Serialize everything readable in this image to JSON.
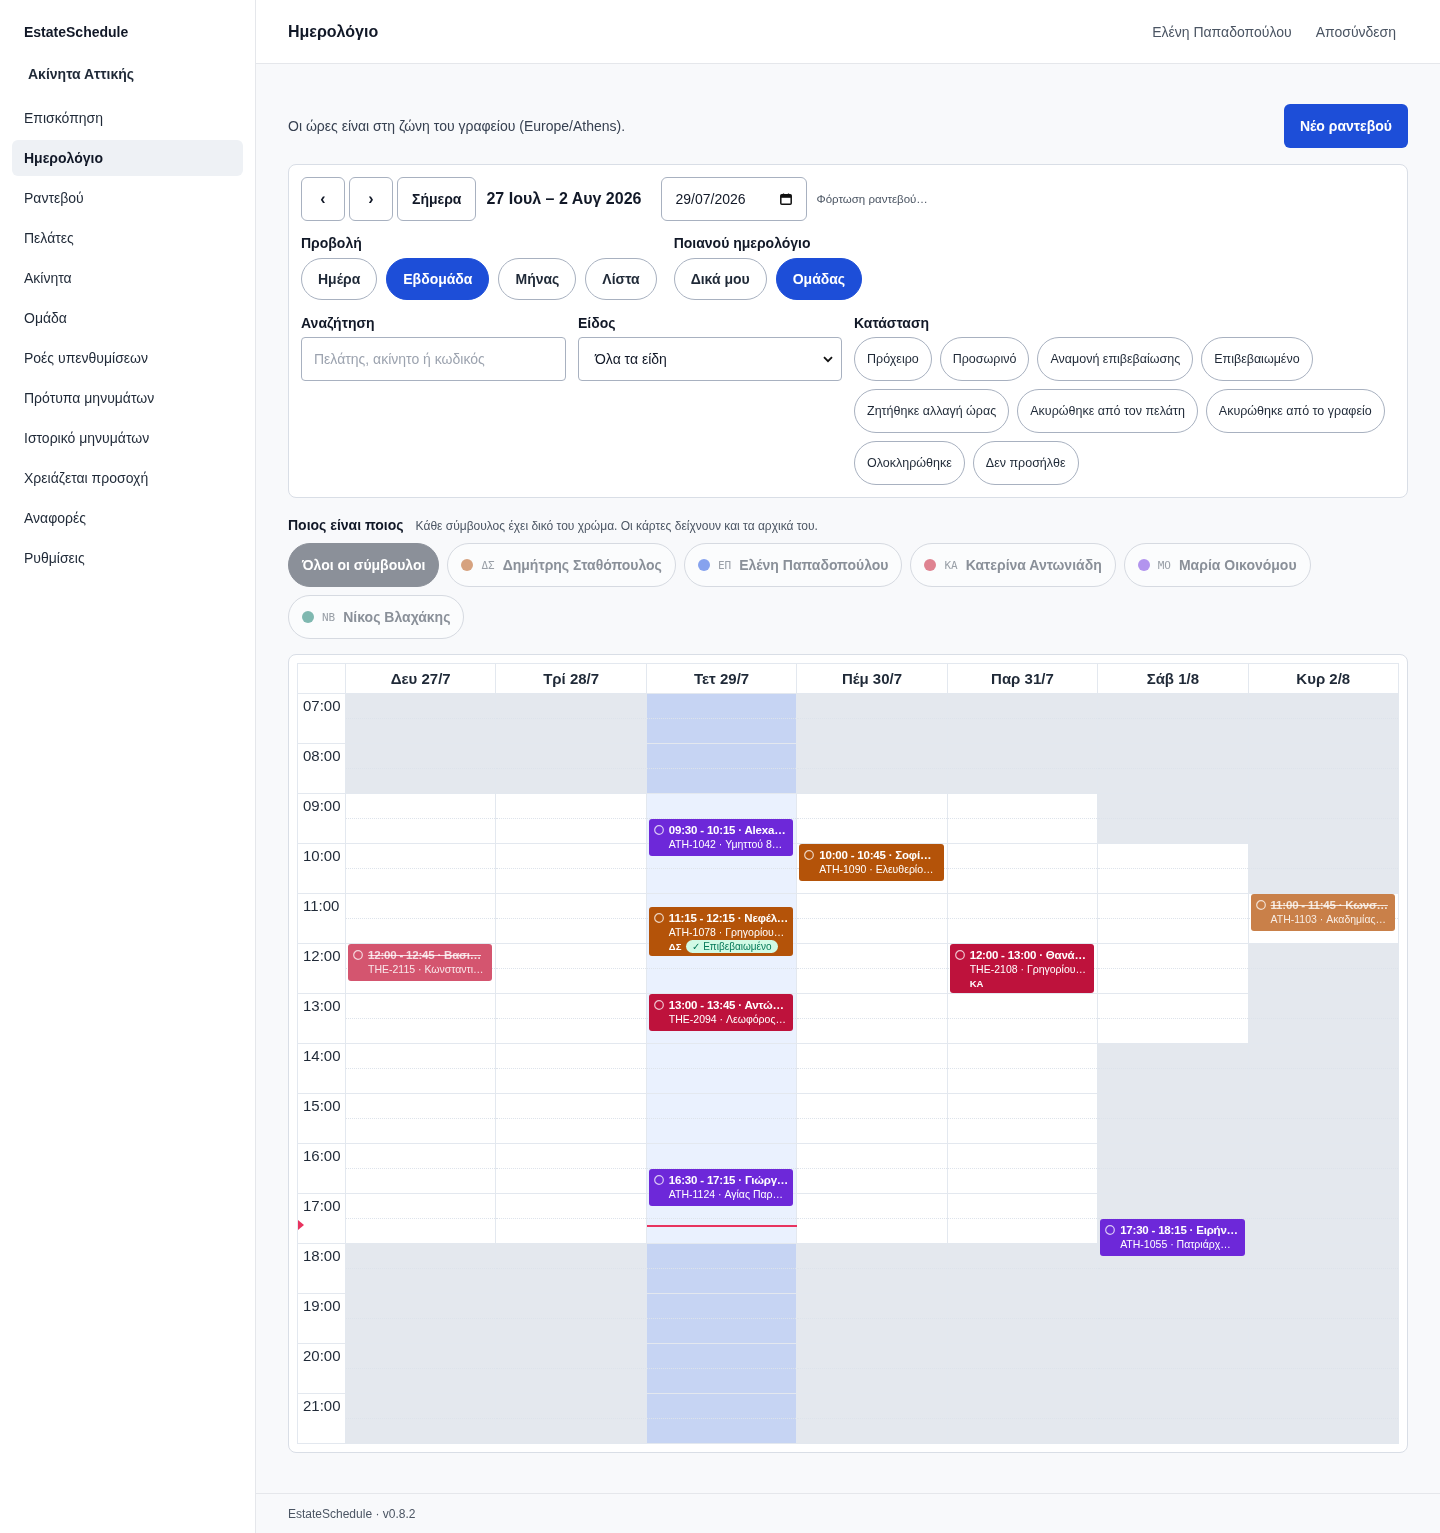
{
  "sidebar": {
    "brand": "EstateSchedule",
    "workspace": "Ακίνητα Αττικής",
    "items": [
      {
        "label": "Επισκόπηση",
        "selected": false
      },
      {
        "label": "Ημερολόγιο",
        "selected": true
      },
      {
        "label": "Ραντεβού",
        "selected": false
      },
      {
        "label": "Πελάτες",
        "selected": false
      },
      {
        "label": "Ακίνητα",
        "selected": false
      },
      {
        "label": "Ομάδα",
        "selected": false
      },
      {
        "label": "Ροές υπενθυμίσεων",
        "selected": false
      },
      {
        "label": "Πρότυπα μηνυμάτων",
        "selected": false
      },
      {
        "label": "Ιστορικό μηνυμάτων",
        "selected": false
      },
      {
        "label": "Χρειάζεται προσοχή",
        "selected": false
      },
      {
        "label": "Αναφορές",
        "selected": false
      },
      {
        "label": "Ρυθμίσεις",
        "selected": false
      }
    ]
  },
  "header": {
    "title": "Ημερολόγιο",
    "user": "Ελένη Παπαδοπούλου",
    "logout": "Αποσύνδεση"
  },
  "timezone_note": "Οι ώρες είναι στη ζώνη του γραφείου (Europe/Athens).",
  "new_button": "Νέο ραντεβού",
  "toolbar": {
    "prev": "‹",
    "next": "›",
    "today": "Σήμερα",
    "range": "27 Ιουλ – 2 Αυγ 2026",
    "date": "29/07/2026",
    "loading": "Φόρτωση ραντεβού…"
  },
  "view": {
    "label": "Προβολή",
    "options": [
      {
        "label": "Ημέρα",
        "selected": false
      },
      {
        "label": "Εβδομάδα",
        "selected": true
      },
      {
        "label": "Μήνας",
        "selected": false
      },
      {
        "label": "Λίστα",
        "selected": false
      }
    ]
  },
  "calendar_scope": {
    "label": "Ποιανού ημερολόγιο",
    "options": [
      {
        "label": "Δικά μου",
        "selected": false
      },
      {
        "label": "Ομάδας",
        "selected": true
      }
    ]
  },
  "search": {
    "label": "Αναζήτηση",
    "placeholder": "Πελάτης, ακίνητο ή κωδικός"
  },
  "type": {
    "label": "Είδος",
    "value": "Όλα τα είδη"
  },
  "status": {
    "label": "Κατάσταση",
    "options": [
      {
        "label": "Πρόχειρο",
        "selected": false
      },
      {
        "label": "Προσωρινό",
        "selected": false
      },
      {
        "label": "Αναμονή επιβεβαίωσης",
        "selected": false
      },
      {
        "label": "Επιβεβαιωμένο",
        "selected": false
      },
      {
        "label": "Ζητήθηκε αλλαγή ώρας",
        "selected": false
      },
      {
        "label": "Ακυρώθηκε από τον πελάτη",
        "selected": false
      },
      {
        "label": "Ακυρώθηκε από το γραφείο",
        "selected": false
      },
      {
        "label": "Ολοκληρώθηκε",
        "selected": false
      },
      {
        "label": "Δεν προσήλθε",
        "selected": false
      }
    ]
  },
  "legend": {
    "title": "Ποιος είναι ποιος",
    "hint": "Κάθε σύμβουλος έχει δικό του χρώμα. Οι κάρτες δείχνουν και τα αρχικά του.",
    "chips": [
      {
        "kind": "all",
        "label": "Όλοι οι σύμβουλοι",
        "selected": true
      },
      {
        "kind": "advisor",
        "initials": "ΔΣ",
        "label": "Δημήτρης Σταθόπουλος",
        "color": "#d6a27f",
        "selected": false
      },
      {
        "kind": "advisor",
        "initials": "ΕΠ",
        "label": "Ελένη Παπαδοπούλου",
        "color": "#86a2ee",
        "selected": false
      },
      {
        "kind": "advisor",
        "initials": "ΚΑ",
        "label": "Κατερίνα Αντωνιάδη",
        "color": "#df8391",
        "selected": false
      },
      {
        "kind": "advisor",
        "initials": "ΜΟ",
        "label": "Μαρία Οικονόμου",
        "color": "#b294ee",
        "selected": false
      },
      {
        "kind": "advisor",
        "initials": "ΝΒ",
        "label": "Νίκος Βλαχάκης",
        "color": "#7fb8b0",
        "selected": false
      }
    ]
  },
  "calendar": {
    "now_line": {
      "level": 0.708
    },
    "days": [
      {
        "label": "Δευ 27/7",
        "today": false,
        "events": [
          {
            "title": "12:00 - 12:45 · Βασι…",
            "details": "THE-2115 · Κωνσταντι…",
            "color": "#d4556f",
            "cancelled": true
          }
        ]
      },
      {
        "label": "Τρί 28/7",
        "today": false
      },
      {
        "label": "Τετ 29/7",
        "today": true,
        "events": [
          {
            "title": "09:30 - 10:15 · Alexa…",
            "details": "ATH-1042 · Υμηττού 8…",
            "color": "#6d28d9",
            "cancelled": false
          },
          {
            "title": "11:15 - 12:15 · Νεφέλ…",
            "details": "ATH-1078 · Γρηγορίου…",
            "color": "#b45309",
            "cancelled": false,
            "initials": "ΔΣ",
            "badge": "✓ Επιβεβαιωμένο"
          },
          {
            "title": "13:00 - 13:45 · Αντώ…",
            "details": "THE-2094 · Λεωφόρος…",
            "color": "#be123c",
            "cancelled": false
          },
          {
            "title": "16:30 - 17:15 · Γιώργ…",
            "details": "ATH-1124 · Αγίας Παρ…",
            "color": "#6d28d9",
            "cancelled": false
          }
        ]
      },
      {
        "label": "Πέμ 30/7",
        "today": false,
        "events": [
          {
            "title": "10:00 - 10:45 · Σοφί…",
            "details": "ATH-1090 · Ελευθερίο…",
            "color": "#b45309",
            "cancelled": false
          }
        ]
      },
      {
        "label": "Παρ 31/7",
        "today": false,
        "events": [
          {
            "title": "12:00 - 13:00 · Θανά…",
            "details": "THE-2108 · Γρηγορίου…",
            "color": "#be123c",
            "cancelled": false,
            "initials": "ΚΑ"
          }
        ]
      },
      {
        "label": "Σάβ 1/8",
        "today": false,
        "events": [
          {
            "title": "17:30 - 18:15 · Ειρήν…",
            "details": "ATH-1055 · Πατριάρχ…",
            "color": "#6d28d9",
            "cancelled": false
          }
        ]
      },
      {
        "label": "Κυρ 2/8",
        "today": false,
        "events": [
          {
            "title": "11:00 - 11:45 · Κωνσ…",
            "details": "ATH-1103 · Ακαδημίας…",
            "color": "#c98049",
            "cancelled": true
          }
        ]
      }
    ],
    "rows": [
      {
        "time": "07:00",
        "open": [
          false,
          false,
          false,
          false,
          false,
          false,
          false
        ]
      },
      {
        "time": "08:00",
        "open": [
          false,
          false,
          false,
          false,
          false,
          false,
          false
        ]
      },
      {
        "time": "09:00",
        "open": [
          true,
          true,
          true,
          true,
          true,
          false,
          false
        ]
      },
      {
        "time": "10:00",
        "open": [
          true,
          true,
          true,
          true,
          true,
          true,
          false
        ]
      },
      {
        "time": "11:00",
        "open": [
          true,
          true,
          true,
          true,
          true,
          true,
          true
        ]
      },
      {
        "time": "12:00",
        "open": [
          true,
          true,
          true,
          true,
          true,
          true,
          false
        ]
      },
      {
        "time": "13:00",
        "open": [
          true,
          true,
          true,
          true,
          true,
          true,
          false
        ]
      },
      {
        "time": "14:00",
        "open": [
          true,
          true,
          true,
          true,
          true,
          false,
          false
        ]
      },
      {
        "time": "15:00",
        "open": [
          true,
          true,
          true,
          true,
          true,
          false,
          false
        ]
      },
      {
        "time": "16:00",
        "open": [
          true,
          true,
          true,
          true,
          true,
          false,
          false
        ]
      },
      {
        "time": "17:00",
        "open": [
          true,
          true,
          true,
          true,
          true,
          false,
          false
        ]
      },
      {
        "time": "18:00",
        "open": [
          false,
          false,
          false,
          false,
          false,
          false,
          false
        ]
      },
      {
        "time": "19:00",
        "open": [
          false,
          false,
          false,
          false,
          false,
          false,
          false
        ]
      },
      {
        "time": "20:00",
        "open": [
          false,
          false,
          false,
          false,
          false,
          false,
          false
        ]
      },
      {
        "time": "21:00",
        "open": [
          false,
          false,
          false,
          false,
          false,
          false,
          false
        ]
      }
    ]
  },
  "footer": "EstateSchedule · v0.8.2"
}
